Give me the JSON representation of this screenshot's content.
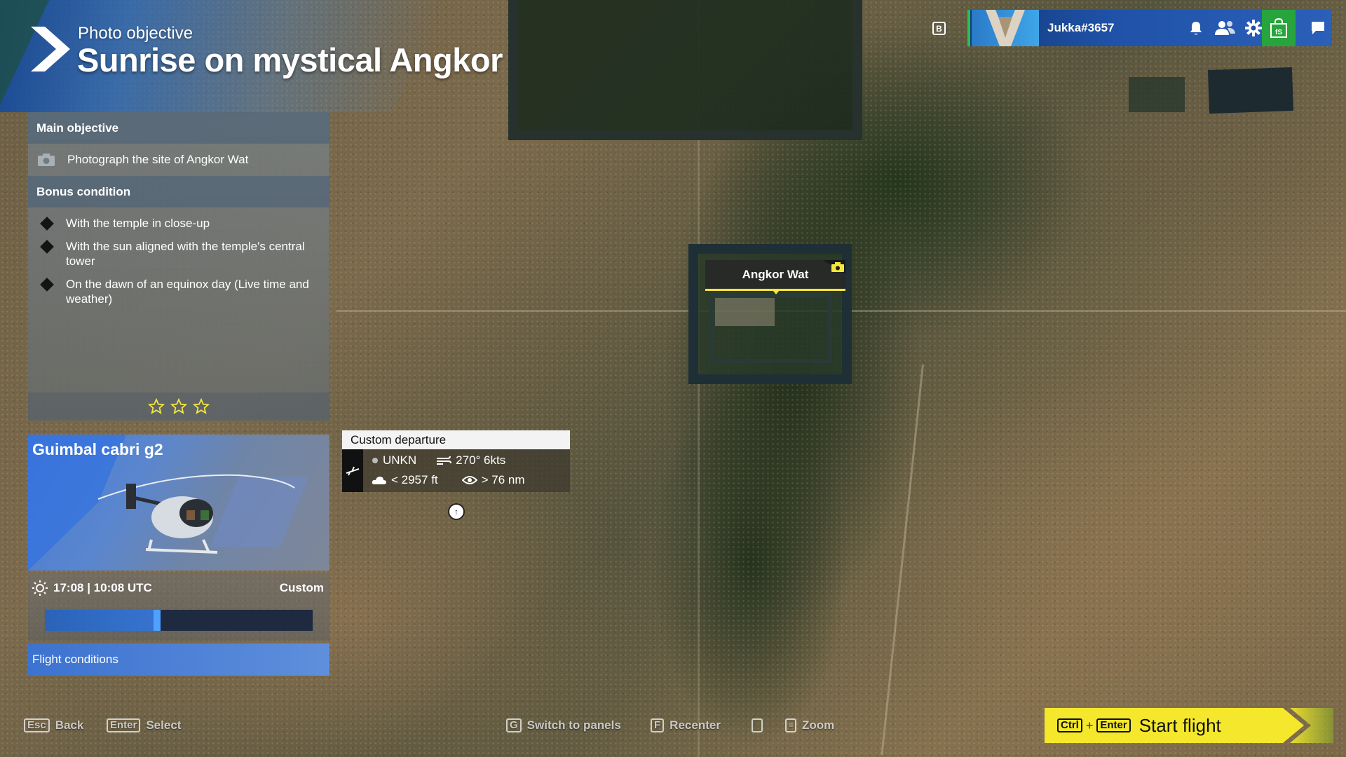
{
  "title": {
    "subtitle": "Photo objective",
    "main": "Sunrise on mystical Angkor"
  },
  "objectives": {
    "main_header": "Main objective",
    "main_text": "Photograph the site of Angkor Wat",
    "bonus_header": "Bonus condition",
    "bonus_items": [
      "With the temple in close-up",
      "With the sun aligned with the temple's central tower",
      "On the dawn of an equinox day (Live time and weather)"
    ],
    "stars_total": 3,
    "stars_earned": 0
  },
  "aircraft": {
    "name": "Guimbal cabri g2"
  },
  "time": {
    "text": "17:08 | 10:08 UTC",
    "mode": "Custom",
    "slider_fraction": 0.42
  },
  "flight_conditions_label": "Flight conditions",
  "departure": {
    "title": "Custom departure",
    "airport": "UNKN",
    "wind": "270° 6kts",
    "cloud": "< 2957 ft",
    "visibility": "> 76 nm"
  },
  "poi": {
    "label": "Angkor Wat"
  },
  "topbar": {
    "key_hint": "B",
    "username": "Jukka#3657",
    "accent_color": "#28c24f"
  },
  "footer": {
    "back_key": "Esc",
    "back_label": "Back",
    "select_key": "Enter",
    "select_label": "Select",
    "panels_key": "G",
    "panels_label": "Switch to panels",
    "recenter_key": "F",
    "recenter_label": "Recenter",
    "zoom_label": "Zoom",
    "start_key1": "Ctrl",
    "start_key2": "Enter",
    "start_label": "Start flight",
    "start_color": "#f5e82c"
  }
}
